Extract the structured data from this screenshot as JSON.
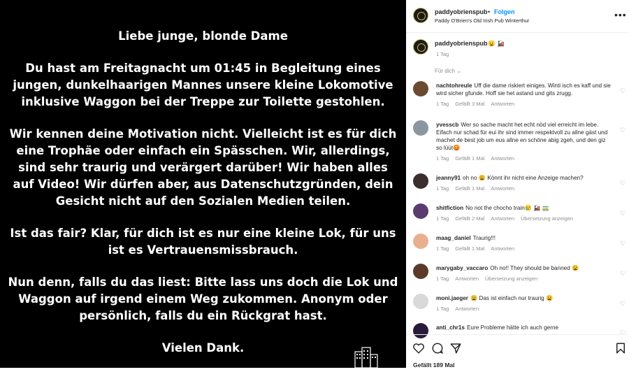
{
  "post": {
    "lines": [
      "Liebe junge, blonde Dame",
      "Du hast am Freitagnacht um 01:45 in Begleitung eines jungen, dunkelhaarigen Mannes unsere kleine Lokomotive inklusive Waggon bei der Treppe zur Toilette gestohlen.",
      "Wir kennen deine Motivation nicht. Vielleicht ist es für dich eine Trophäe oder einfach ein Spässchen. Wir, allerdings, sind sehr traurig und verärgert darüber! Wir haben alles auf Video! Wir dürfen aber, aus Datenschutzgründen, dein Gesicht nicht auf den Sozialen Medien teilen.",
      "Ist das fair? Klar, für dich ist es nur eine kleine Lok, für uns ist es Vertrauensmissbrauch.",
      "Nun denn, falls du das liest: Bitte lass uns doch die Lok und Waggon auf irgend einem Weg zukommen. Anonym oder persönlich, falls du ein Rückgrat hast.",
      "Vielen Dank."
    ]
  },
  "header": {
    "username": "paddyobrienspub",
    "dot": "•",
    "follow": "Folgen",
    "location": "Paddy O'Brien's Old Irish Pub Winterthur",
    "more": "•••"
  },
  "caption": {
    "username": "paddyobrienspub",
    "text": "😦 🚂",
    "time": "1 Tag"
  },
  "for_you": "Für dich ⌄",
  "comments": [
    {
      "user": "nachtohreule",
      "text": "Uff die dame riskiert einiges. Winti isch es kaff und sie wird sicher gfunde. Hoff sie het astand und gits zrugg.",
      "time": "1 Tag",
      "likes": "Gefällt 3 Mal",
      "reply": "Antworten",
      "translate": "",
      "color": "#6b4a32"
    },
    {
      "user": "yvesscb",
      "text": "Wer so sache macht het echt nöd viel erreicht im lebe. Eifach nur schad für eui ihr sind immer respektvoll zu allne gäst und machet de best job um eus allne en schöne abig zgeh, und den giz so lüüt😡",
      "time": "1 Tag",
      "likes": "Gefällt 1 Mal",
      "reply": "Antworten",
      "translate": "",
      "color": "#8a96a0"
    },
    {
      "user": "jeanny91",
      "text": "oh no 😩 Könnt ihr nicht eine Anzeige machen?",
      "time": "1 Tag",
      "likes": "Gefällt 1 Mal",
      "reply": "Antworten",
      "translate": "",
      "color": "#3b2e2e"
    },
    {
      "user": "shitfiction",
      "text": "No not the chocho train😢 🚂 🚃",
      "time": "1 Tag",
      "likes": "Gefällt 2 Mal",
      "reply": "Antworten",
      "translate": "Übersetzung anzeigen",
      "color": "#5a3b6e"
    },
    {
      "user": "maag_daniel",
      "text": "Traurig!!!",
      "time": "1 Tag",
      "likes": "Gefällt 1 Mal",
      "reply": "Antworten",
      "translate": "",
      "color": "#e8b090"
    },
    {
      "user": "marygaby_vaccaro",
      "text": "Oh no!! They should be banned 😩",
      "time": "1 Tag",
      "likes": "",
      "reply": "Antworten",
      "translate": "Übersetzung anzeigen",
      "color": "#5b3a2a"
    },
    {
      "user": "moni.jaeger",
      "text": "😩 Das ist einfach nur traurig 😩",
      "time": "1 Tag",
      "likes": "",
      "reply": "Antworten",
      "translate": "",
      "color": "#d9d9d9"
    },
    {
      "user": "anti_chr1s",
      "text": "Eure Probleme hätte ich auch gerne",
      "time": "",
      "likes": "",
      "reply": "",
      "translate": "",
      "color": "#2a1a3a"
    }
  ],
  "footer": {
    "likes": "Gefällt 189 Mal",
    "icons": [
      "heart-icon",
      "comment-icon",
      "share-icon",
      "bookmark-icon"
    ]
  }
}
